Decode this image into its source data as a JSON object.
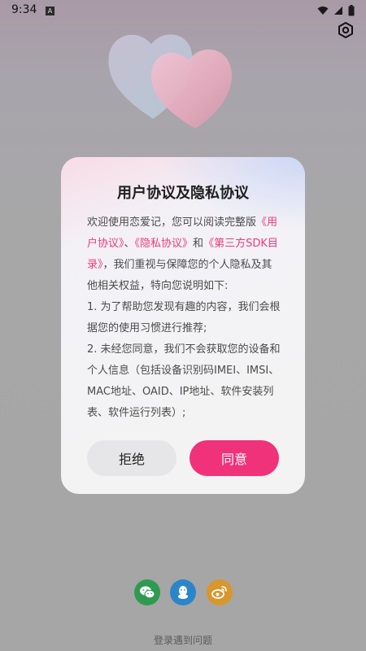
{
  "status_bar": {
    "time": "9:34",
    "notification_icon": "A"
  },
  "icons": {
    "settings": "settings-hex-icon",
    "wifi": "wifi-icon",
    "signal": "signal-icon",
    "battery": "battery-icon",
    "wechat": "wechat-icon",
    "qq": "qq-icon",
    "weibo": "weibo-icon"
  },
  "dialog": {
    "title": "用户协议及隐私协议",
    "para1": {
      "prefix": "欢迎使用恋爱记，您可以阅读完整版",
      "link_user": "《用户协议》",
      "sep": "、",
      "link_privacy": "《隐私协议》",
      "and": "和",
      "link_sdk": "《第三方SDK目录》",
      "suffix": "，我们重视与保障您的个人隐私及其他相关权益，特向您说明如下:"
    },
    "point1": "1. 为了帮助您发现有趣的内容，我们会根据您的使用习惯进行推荐;",
    "point2": "2. 未经您同意，我们不会获取您的设备和个人信息（包括设备识别码IMEI、IMSI、MAC地址、OAID、IP地址、软件安装列表、软件运行列表）;",
    "reject_label": "拒绝",
    "agree_label": "同意"
  },
  "login_help": "登录遇到问题",
  "colors": {
    "accent": "#f0327a",
    "link": "#ee3a7c",
    "wechat": "#2f9a52",
    "qq": "#2a86c8",
    "weibo": "#d9962c"
  }
}
